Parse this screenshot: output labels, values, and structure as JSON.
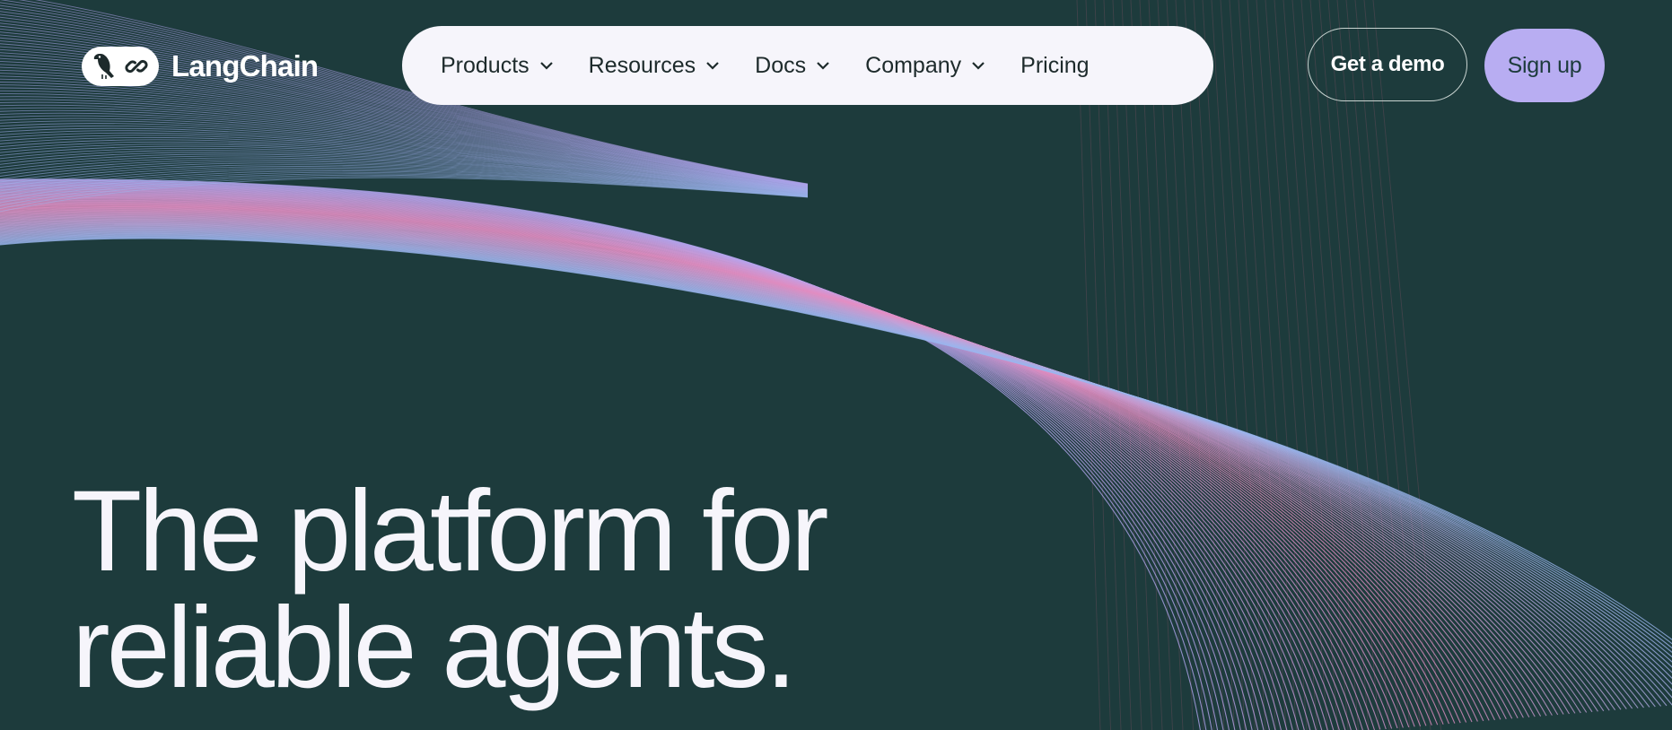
{
  "brand": {
    "name": "LangChain",
    "logo_icons": [
      "parrot-icon",
      "chain-link-icon"
    ]
  },
  "nav": {
    "items": [
      {
        "label": "Products",
        "has_dropdown": true
      },
      {
        "label": "Resources",
        "has_dropdown": true
      },
      {
        "label": "Docs",
        "has_dropdown": true
      },
      {
        "label": "Company",
        "has_dropdown": true
      },
      {
        "label": "Pricing",
        "has_dropdown": false
      }
    ]
  },
  "actions": {
    "demo_label": "Get a demo",
    "signup_label": "Sign up"
  },
  "hero": {
    "line1": "The platform for",
    "line2": "reliable agents."
  },
  "colors": {
    "background": "#1d3b3c",
    "nav_background": "#f6f5fb",
    "signup_button": "#b8adf2",
    "line_lavender": "#b4a6f0",
    "line_pink": "#e58fc4",
    "line_blue": "#9ab6ee",
    "line_red": "#c0607e"
  }
}
